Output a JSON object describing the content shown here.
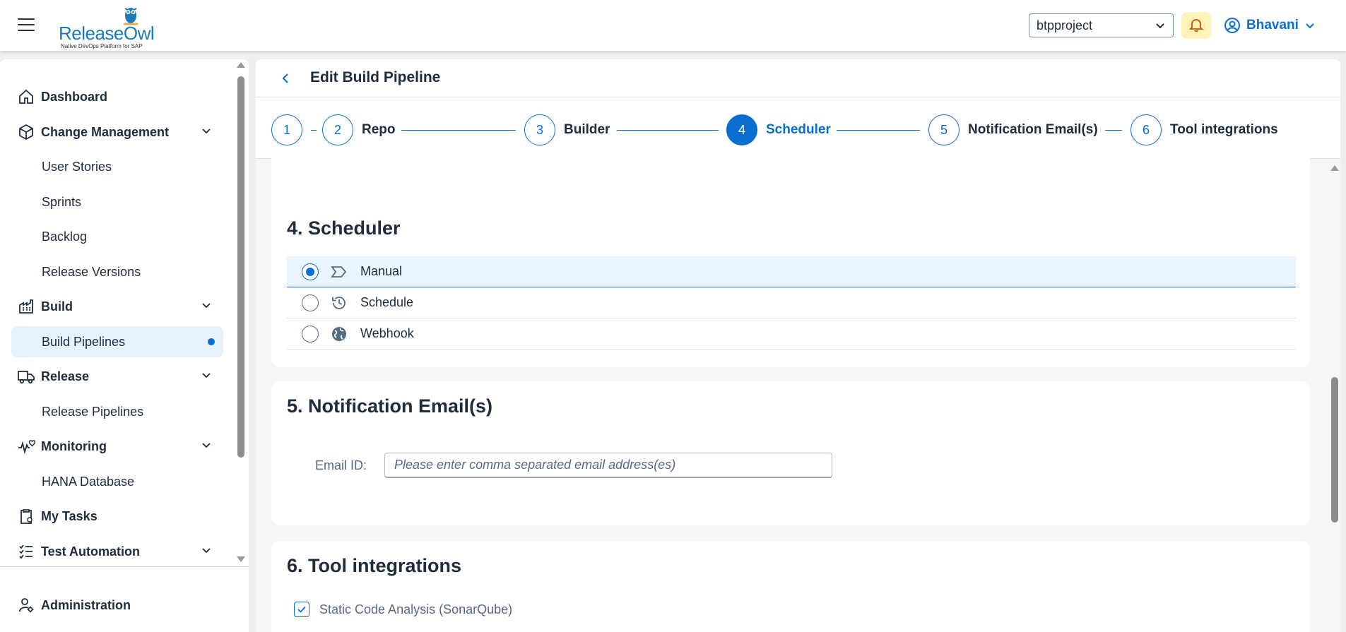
{
  "app": {
    "logo_text": "ReleaseOwl",
    "logo_tagline": "Native DevOps Platform for SAP",
    "project_selector": "btpproject",
    "user_name": "Bhavani"
  },
  "colors": {
    "accent": "#0a6ed1",
    "bell_bg": "#fff3b8",
    "active_nav_bg": "#e8f2fc",
    "text": "#1d2d3e"
  },
  "sidebar": {
    "items": [
      {
        "label": "Dashboard",
        "type": "group",
        "icon": "home-icon"
      },
      {
        "label": "Change Management",
        "type": "group",
        "icon": "change-management-icon",
        "expandable": true
      },
      {
        "label": "User Stories",
        "type": "sub"
      },
      {
        "label": "Sprints",
        "type": "sub"
      },
      {
        "label": "Backlog",
        "type": "sub"
      },
      {
        "label": "Release Versions",
        "type": "sub"
      },
      {
        "label": "Build",
        "type": "group",
        "icon": "factory-icon",
        "expandable": true
      },
      {
        "label": "Build Pipelines",
        "type": "sub",
        "active": true
      },
      {
        "label": "Release",
        "type": "group",
        "icon": "truck-icon",
        "expandable": true
      },
      {
        "label": "Release Pipelines",
        "type": "sub"
      },
      {
        "label": "Monitoring",
        "type": "group",
        "icon": "heartbeat-icon",
        "expandable": true
      },
      {
        "label": "HANA Database",
        "type": "sub"
      },
      {
        "label": "My Tasks",
        "type": "group",
        "icon": "clipboard-icon"
      },
      {
        "label": "Test Automation",
        "type": "group",
        "icon": "checklist-icon",
        "expandable": true
      }
    ],
    "footer_item": {
      "label": "Administration",
      "icon": "user-settings-icon"
    }
  },
  "page": {
    "title": "Edit Build Pipeline"
  },
  "wizard": {
    "steps": [
      {
        "number": "1",
        "label": ""
      },
      {
        "number": "2",
        "label": "Repo"
      },
      {
        "number": "3",
        "label": "Builder"
      },
      {
        "number": "4",
        "label": "Scheduler",
        "current": true
      },
      {
        "number": "5",
        "label": "Notification Email(s)"
      },
      {
        "number": "6",
        "label": "Tool integrations"
      }
    ]
  },
  "scheduler": {
    "heading": "4. Scheduler",
    "options": [
      {
        "label": "Manual",
        "icon": "manual-tag-icon",
        "selected": true
      },
      {
        "label": "Schedule",
        "icon": "history-icon",
        "selected": false
      },
      {
        "label": "Webhook",
        "icon": "globe-icon",
        "selected": false
      }
    ]
  },
  "notification": {
    "heading": "5. Notification Email(s)",
    "email_label": "Email ID:",
    "email_value": "",
    "email_placeholder": "Please enter comma separated email address(es)"
  },
  "tools": {
    "heading": "6. Tool integrations",
    "items": [
      {
        "label": "Static Code Analysis (SonarQube)",
        "checked": true
      }
    ]
  }
}
